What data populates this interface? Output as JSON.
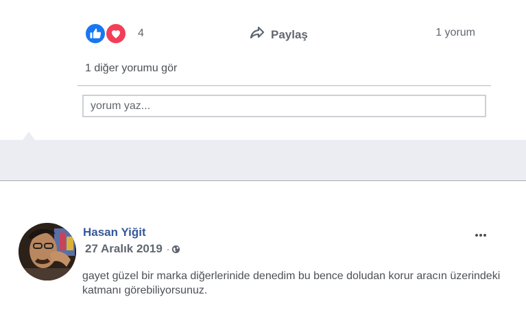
{
  "reactions": {
    "icons": [
      "like-icon",
      "love-icon"
    ],
    "count": "4",
    "colors": {
      "like": "#1877f2",
      "love": "#f33e58"
    }
  },
  "share": {
    "label": "Paylaş",
    "icon": "share-arrow-icon"
  },
  "comments": {
    "count_label": "1 yorum",
    "more_link": "1 diğer yorumu gör",
    "input_placeholder": "yorum yaz..."
  },
  "post": {
    "author": "Hasan Yiğit",
    "date": "27 Aralık 2019",
    "separator": "·",
    "privacy_icon": "globe-icon",
    "options_icon": "more-options-icon",
    "text": "gayet güzel bir marka diğerlerinide denedim bu bence doludan korur aracın üzerindeki katmanı görebiliyorsunuz.",
    "author_color": "#365899"
  }
}
